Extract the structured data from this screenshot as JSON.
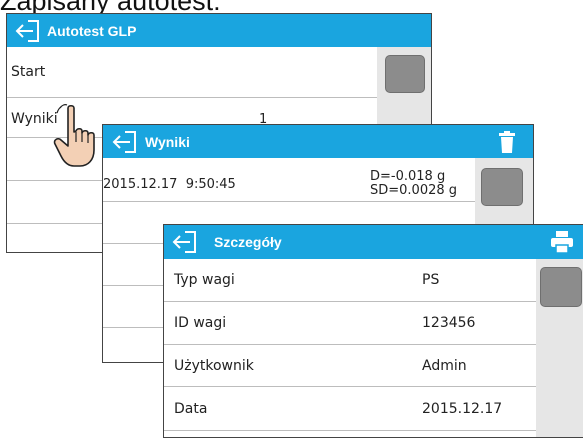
{
  "heading": "Zapisany autotest:",
  "glp": {
    "title": "Autotest GLP",
    "rows": [
      {
        "label": "Start",
        "value": ""
      },
      {
        "label": "Wyniki",
        "value": "1"
      }
    ]
  },
  "wyniki": {
    "title": "Wyniki",
    "entry": {
      "datetime": "2015.12.17  9:50:45",
      "d": "D=-0.018 g",
      "sd": "SD=0.0028 g"
    }
  },
  "szczegoly": {
    "title": "Szczegóły",
    "rows": [
      {
        "label": "Typ wagi",
        "value": "PS"
      },
      {
        "label": "ID wagi",
        "value": "123456"
      },
      {
        "label": "Użytkownik",
        "value": "Admin"
      },
      {
        "label": "Data",
        "value": "2015.12.17"
      }
    ]
  },
  "icons": {
    "back": "back-arrow-icon",
    "trash": "trash-icon",
    "printer": "printer-icon",
    "hand": "pointing-hand-icon"
  },
  "colors": {
    "titlebar": "#1aa5df",
    "scroll_track": "#e6e6e6",
    "scroll_thumb": "#8c8c8c"
  }
}
